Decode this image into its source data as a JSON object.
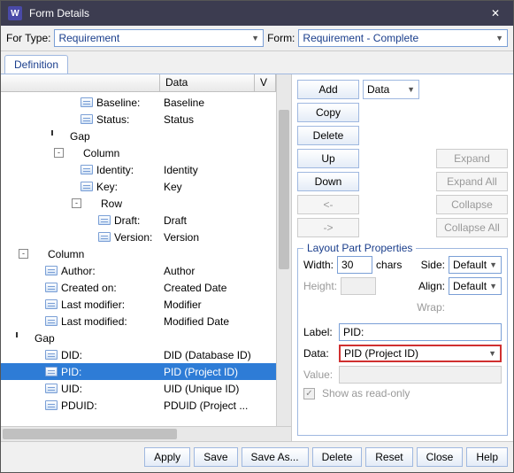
{
  "titlebar": {
    "title": "Form Details"
  },
  "toolbar": {
    "for_type_label": "For Type:",
    "for_type_value": "Requirement",
    "form_label": "Form:",
    "form_value": "Requirement - Complete"
  },
  "tabs": {
    "definition": "Definition"
  },
  "tree": {
    "headers": {
      "col1": "",
      "col2": "Data",
      "col3": "V"
    },
    "rows": [
      {
        "indent": 90,
        "exp": "",
        "icon": "field",
        "label": "Baseline:",
        "data": "Baseline"
      },
      {
        "indent": 90,
        "exp": "",
        "icon": "field",
        "label": "Status:",
        "data": "Status"
      },
      {
        "indent": 60,
        "exp": "",
        "icon": "gap",
        "label": "Gap",
        "data": ""
      },
      {
        "indent": 60,
        "exp": "-",
        "icon": "col",
        "label": "Column",
        "data": ""
      },
      {
        "indent": 90,
        "exp": "",
        "icon": "field",
        "label": "Identity:",
        "data": "Identity"
      },
      {
        "indent": 90,
        "exp": "",
        "icon": "field",
        "label": "Key:",
        "data": "Key"
      },
      {
        "indent": 80,
        "exp": "-",
        "icon": "row",
        "label": "Row",
        "data": ""
      },
      {
        "indent": 110,
        "exp": "",
        "icon": "field",
        "label": "Draft:",
        "data": "Draft"
      },
      {
        "indent": 110,
        "exp": "",
        "icon": "field",
        "label": "Version:",
        "data": "Version"
      },
      {
        "indent": 20,
        "exp": "-",
        "icon": "col",
        "label": "Column",
        "data": ""
      },
      {
        "indent": 50,
        "exp": "",
        "icon": "field",
        "label": "Author:",
        "data": "Author"
      },
      {
        "indent": 50,
        "exp": "",
        "icon": "field",
        "label": "Created on:",
        "data": "Created Date"
      },
      {
        "indent": 50,
        "exp": "",
        "icon": "field",
        "label": "Last modifier:",
        "data": "Modifier"
      },
      {
        "indent": 50,
        "exp": "",
        "icon": "field",
        "label": "Last modified:",
        "data": "Modified Date"
      },
      {
        "indent": 20,
        "exp": "",
        "icon": "gap",
        "label": "Gap",
        "data": ""
      },
      {
        "indent": 50,
        "exp": "",
        "icon": "field",
        "label": "DID:",
        "data": "DID (Database ID)"
      },
      {
        "indent": 50,
        "exp": "",
        "icon": "field",
        "label": "PID:",
        "data": "PID (Project ID)",
        "selected": true
      },
      {
        "indent": 50,
        "exp": "",
        "icon": "field",
        "label": "UID:",
        "data": "UID (Unique ID)"
      },
      {
        "indent": 50,
        "exp": "",
        "icon": "field",
        "label": "PDUID:",
        "data": "PDUID (Project ..."
      }
    ]
  },
  "actions": {
    "add": "Add",
    "add_type": "Data",
    "copy": "Copy",
    "delete": "Delete",
    "up": "Up",
    "down": "Down",
    "left": "<-",
    "right": "->",
    "expand": "Expand",
    "expand_all": "Expand All",
    "collapse": "Collapse",
    "collapse_all": "Collapse All"
  },
  "props": {
    "group_title": "Layout Part Properties",
    "width_label": "Width:",
    "width_value": "30",
    "width_unit": "chars",
    "height_label": "Height:",
    "side_label": "Side:",
    "side_value": "Default",
    "align_label": "Align:",
    "align_value": "Default",
    "wrap_label": "Wrap:",
    "label_label": "Label:",
    "label_value": "PID:",
    "data_label": "Data:",
    "data_value": "PID (Project ID)",
    "value_label": "Value:",
    "readonly_label": "Show as read-only"
  },
  "footer": {
    "apply": "Apply",
    "save": "Save",
    "save_as": "Save As...",
    "delete": "Delete",
    "reset": "Reset",
    "close": "Close",
    "help": "Help"
  }
}
